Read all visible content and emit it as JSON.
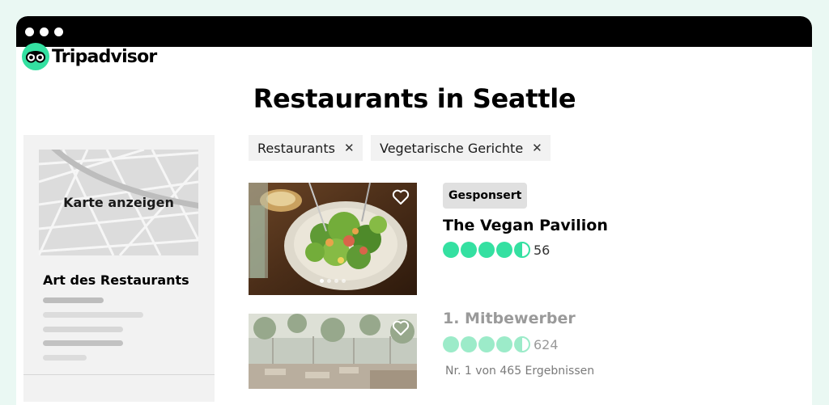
{
  "window": {
    "dots": 3
  },
  "brand": {
    "name": "Tripadvisor",
    "color": "#34e0a1",
    "icon": "owl-eyes-icon"
  },
  "page": {
    "title": "Restaurants in Seattle"
  },
  "sidebar": {
    "map_label": "Karte anzeigen",
    "section_title": "Art des Restaurants"
  },
  "filters": [
    {
      "label": "Restaurants",
      "remove": "✕"
    },
    {
      "label": "Vegetarische Gerichte",
      "remove": "✕"
    }
  ],
  "results": [
    {
      "badge": "Gesponsert",
      "name": "The Vegan Pavilion",
      "rating": 4.5,
      "reviews": "56",
      "carousel": {
        "count": 4,
        "active": 0
      }
    },
    {
      "name": "1. Mitbewerber",
      "rating": 4.5,
      "reviews": "624",
      "rank_text": "Nr. 1 von 465 Ergebnissen",
      "muted": true
    }
  ],
  "colors": {
    "rating": "#34e0a1",
    "rating_muted": "#9cebc9",
    "chip_bg": "#f2f2f2",
    "titlebar": "#000000",
    "background": "#eaf8f3"
  }
}
